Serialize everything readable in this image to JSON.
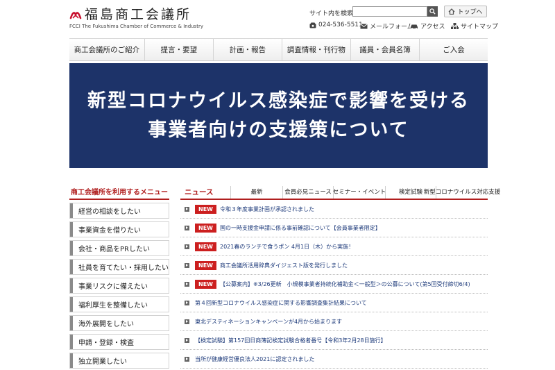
{
  "header": {
    "logo_text": "福島商工会議所",
    "logo_sub": "FCCI The Fukushima Chamber of Commerce & Industry",
    "search_label": "サイト内を検索",
    "search_value": "",
    "top_link": "トップへ",
    "phone": "024-536-5511",
    "mail": "メールフォーム",
    "access": "アクセス",
    "sitemap": "サイトマップ"
  },
  "nav": [
    "商工会議所のご紹介",
    "提言・要望",
    "計画・報告",
    "調査情報・刊行物",
    "議員・会員名簿",
    "ご入会"
  ],
  "banner": {
    "line1": "新型コロナウイルス感染症で影響を受ける",
    "line2": "事業者向けの支援策について",
    "bg_color": "#1d3369"
  },
  "side_menu": {
    "title": "商工会議所を利用するメニュー",
    "items": [
      "経営の相談をしたい",
      "事業資金を借りたい",
      "会社・商品をPRしたい",
      "社員を育てたい・採用したい",
      "事業リスクに備えたい",
      "福利厚生を整備したい",
      "海外展開をしたい",
      "申請・登録・検査",
      "独立開業したい"
    ]
  },
  "news": {
    "heading": "ニュース",
    "tabs": [
      "最新",
      "会員必見ニュース",
      "セミナー・イベント",
      "検定試験",
      "新型コロナウイルス対応支援"
    ],
    "badge": "NEW",
    "accent_color": "#b01e1e",
    "items": [
      {
        "new": true,
        "text": "令和３年度事業計画が承認されました"
      },
      {
        "new": true,
        "text": "国の一時支援金申請に係る事前確認について【会員事業者限定】"
      },
      {
        "new": true,
        "text": "2021春のランチで食うポン 4月1日（木）から実施！"
      },
      {
        "new": true,
        "text": "商工会議所活用辞典ダイジェスト版を発行しました"
      },
      {
        "new": true,
        "text": "【公募案内】※3/26更新　小規模事業者持続化補助金＜一般型＞の公募について(第5回受付締切6/4)"
      },
      {
        "new": false,
        "text": "第４回新型コロナウイルス感染症に関する影響調査集計結果について"
      },
      {
        "new": false,
        "text": "東北デスティネーションキャンペーンが4月から始まります"
      },
      {
        "new": false,
        "text": "【検定試験】第157回日商簿記検定試験合格者番号【令和3年2月28日施行】"
      },
      {
        "new": false,
        "text": "当所が健康経営優良法人2021に認定されました"
      }
    ]
  }
}
